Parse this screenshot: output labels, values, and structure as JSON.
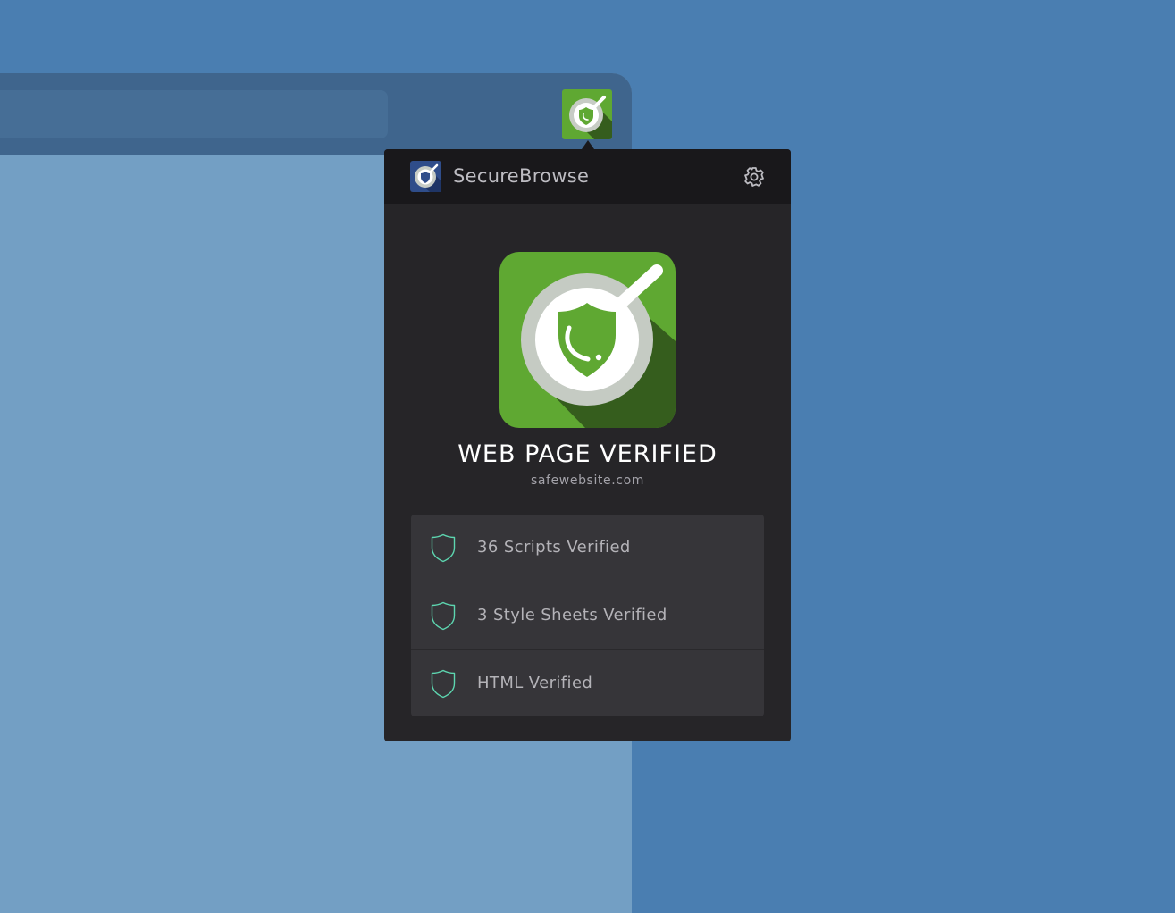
{
  "extension": {
    "toolbar_icon": "securebrowse-extension-icon",
    "brand_color": "#5fa832"
  },
  "popup": {
    "app_name": "SecureBrowse",
    "logo_icon": "securebrowse-logo-icon",
    "settings_icon": "gear-icon",
    "status_icon": "verified-magnifier-shield-icon",
    "status_title": "WEB PAGE VERIFIED",
    "domain": "safewebsite.com",
    "checks": [
      {
        "label": "36 Scripts Verified",
        "icon": "shield-outline-icon"
      },
      {
        "label": "3 Style Sheets Verified",
        "icon": "shield-outline-icon"
      },
      {
        "label": "HTML Verified",
        "icon": "shield-outline-icon"
      }
    ],
    "accent_color": "#5dd6b0"
  }
}
